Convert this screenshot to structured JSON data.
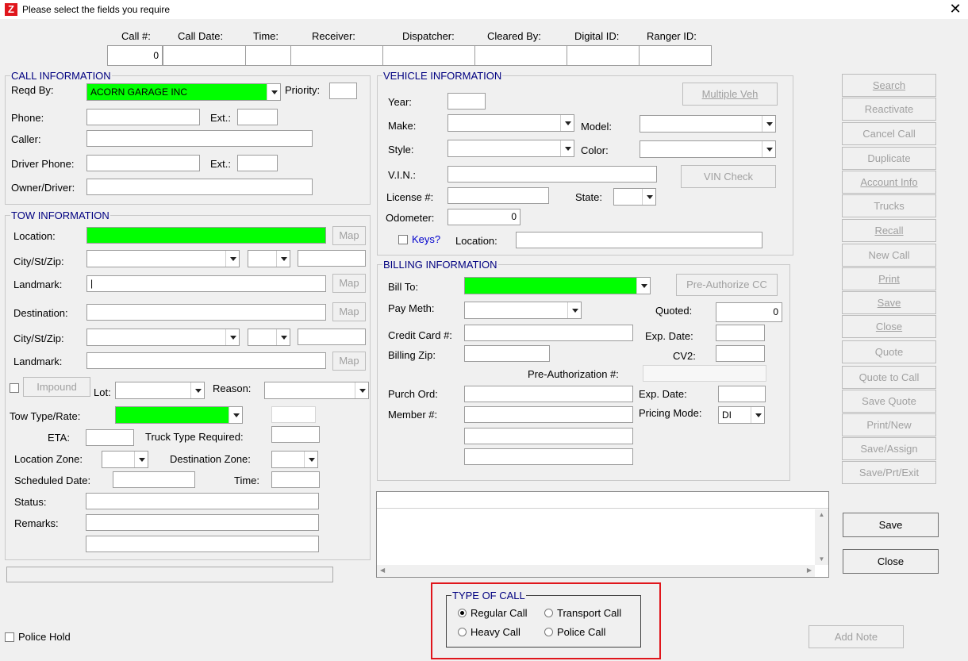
{
  "window": {
    "title": "Please select the fields you require",
    "app_icon": "Z"
  },
  "header": {
    "columns": [
      "Call #:",
      "Call Date:",
      "Time:",
      "Receiver:",
      "Dispatcher:",
      "Cleared By:",
      "Digital ID:",
      "Ranger ID:"
    ],
    "call_number": "0"
  },
  "call_info": {
    "legend": "CALL INFORMATION",
    "reqd_by_label": "Reqd By:",
    "reqd_by_value": "ACORN GARAGE INC",
    "priority_label": "Priority:",
    "phone_label": "Phone:",
    "ext_label": "Ext.:",
    "caller_label": "Caller:",
    "driver_phone_label": "Driver Phone:",
    "ext2_label": "Ext.:",
    "owner_label": "Owner/Driver:"
  },
  "tow_info": {
    "legend": "TOW INFORMATION",
    "location_label": "Location:",
    "map_label": "Map",
    "city_label": "City/St/Zip:",
    "landmark_label": "Landmark:",
    "destination_label": "Destination:",
    "city2_label": "City/St/Zip:",
    "landmark2_label": "Landmark:",
    "impound_label": "Impound",
    "lot_label": "Lot:",
    "reason_label": "Reason:",
    "tow_type_label": "Tow Type/Rate:",
    "eta_label": "ETA:",
    "truck_type_label": "Truck Type Required:",
    "location_zone_label": "Location Zone:",
    "destination_zone_label": "Destination Zone:",
    "scheduled_date_label": "Scheduled Date:",
    "time_label": "Time:",
    "status_label": "Status:",
    "remarks_label": "Remarks:"
  },
  "vehicle_info": {
    "legend": "VEHICLE INFORMATION",
    "multiple_veh_label": "Multiple Veh",
    "year_label": "Year:",
    "make_label": "Make:",
    "model_label": "Model:",
    "style_label": "Style:",
    "color_label": "Color:",
    "vin_label": "V.I.N.:",
    "vin_check_label": "VIN Check",
    "license_label": "License #:",
    "state_label": "State:",
    "odometer_label": "Odometer:",
    "odometer_value": "0",
    "keys_label": "Keys?",
    "location_label": "Location:"
  },
  "billing_info": {
    "legend": "BILLING INFORMATION",
    "bill_to_label": "Bill To:",
    "preauth_cc_label": "Pre-Authorize CC",
    "pay_meth_label": "Pay Meth:",
    "quoted_label": "Quoted:",
    "quoted_value": "0",
    "credit_card_label": "Credit Card #:",
    "exp_date_label": "Exp. Date:",
    "billing_zip_label": "Billing Zip:",
    "cv2_label": "CV2:",
    "preauth_num_label": "Pre-Authorization #:",
    "purch_ord_label": "Purch Ord:",
    "exp_date2_label": "Exp. Date:",
    "member_label": "Member #:",
    "pricing_mode_label": "Pricing Mode:",
    "pricing_mode_value": "DI"
  },
  "side_buttons": [
    "Search",
    "Reactivate",
    "Cancel Call",
    "Duplicate",
    "Account Info",
    "Trucks",
    "Recall",
    "New Call",
    "Print",
    "Save",
    "Close",
    "Quote",
    "Quote to Call",
    "Save Quote",
    "Print/New",
    "Save/Assign",
    "Save/Prt/Exit"
  ],
  "actions": {
    "save_label": "Save",
    "close_label": "Close",
    "add_note_label": "Add Note"
  },
  "type_of_call": {
    "legend": "TYPE OF CALL",
    "options": [
      "Regular Call",
      "Transport Call",
      "Heavy Call",
      "Police Call"
    ],
    "selected": "Regular Call"
  },
  "police_hold_label": "Police Hold",
  "colors": {
    "required_field": "#00ff00",
    "highlight_box": "#e0161c",
    "legend_text": "#000080"
  }
}
